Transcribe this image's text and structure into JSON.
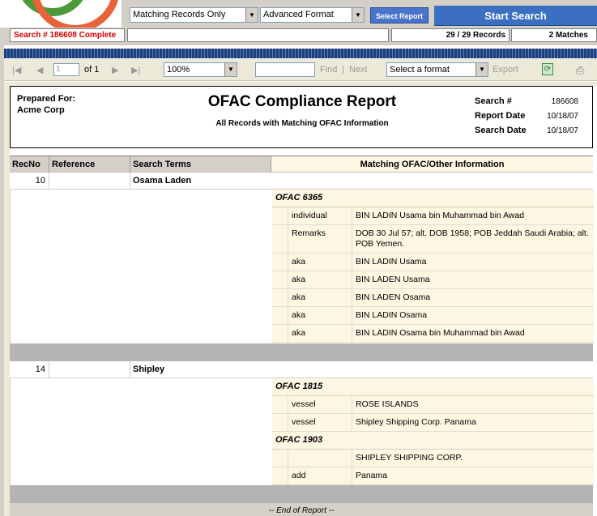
{
  "toolbar": {
    "filter_select": "Matching Records Only",
    "format_select": "Advanced Format",
    "select_report_label": "Select Report",
    "start_search_label": "Start Search"
  },
  "status": {
    "search_status": "Search # 186608 Complete",
    "records": "29 / 29 Records",
    "matches": "2 Matches"
  },
  "viewer": {
    "page_input": "1",
    "page_of": "of 1",
    "zoom": "100%",
    "find_label": "Find",
    "separator": "|",
    "next_label": "Next",
    "format_select": "Select a format",
    "export_label": "Export"
  },
  "report": {
    "prepared_for_label": "Prepared For:",
    "prepared_for_name": "Acme Corp",
    "title": "OFAC Compliance Report",
    "subtitle": "All Records with Matching OFAC Information",
    "search_no_label": "Search #",
    "search_no": "186608",
    "report_date_label": "Report Date",
    "report_date": "10/18/07",
    "search_date_label": "Search Date",
    "search_date": "10/18/07",
    "columns": [
      "RecNo",
      "Reference",
      "Search Terms",
      "Matching OFAC/Other Information"
    ],
    "records": [
      {
        "recno": "10",
        "reference": "",
        "search_terms": "Osama Laden",
        "matches": [
          {
            "sdn": "OFAC 6365",
            "details": [
              {
                "type": "individual",
                "text": "BIN LADIN Usama bin Muhammad bin Awad"
              },
              {
                "type": "Remarks",
                "text": "DOB 30 Jul 57; alt. DOB 1958; POB Jeddah Saudi Arabia; alt. POB Yemen."
              },
              {
                "type": "aka",
                "text": "BIN LADIN Usama"
              },
              {
                "type": "aka",
                "text": "BIN LADEN Usama"
              },
              {
                "type": "aka",
                "text": "BIN LADEN Osama"
              },
              {
                "type": "aka",
                "text": "BIN LADIN Osama"
              },
              {
                "type": "aka",
                "text": "BIN LADIN Osama bin Muhammad bin Awad"
              }
            ]
          }
        ]
      },
      {
        "recno": "14",
        "reference": "",
        "search_terms": "Shipley",
        "matches": [
          {
            "sdn": "OFAC 1815",
            "details": [
              {
                "type": "vessel",
                "text": "ROSE ISLANDS"
              },
              {
                "type": "vessel",
                "text": "Shipley Shipping Corp. Panama"
              }
            ]
          },
          {
            "sdn": "OFAC 1903",
            "details": [
              {
                "type": "",
                "text": "SHIPLEY SHIPPING CORP."
              },
              {
                "type": "add",
                "text": "Panama"
              }
            ]
          }
        ]
      }
    ],
    "end_label": "-- End of Report --"
  }
}
